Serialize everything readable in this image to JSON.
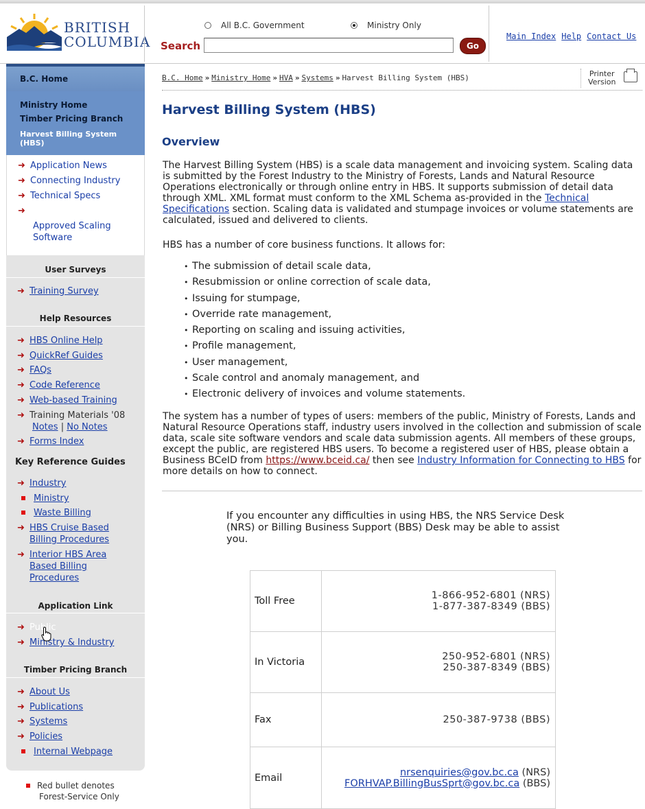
{
  "header": {
    "logo_line1": "BRITISH",
    "logo_line2": "COLUMBIA",
    "search_scope_all": "All B.C. Government",
    "search_scope_ministry": "Ministry Only",
    "search_label": "Search",
    "search_value": "",
    "go_label": "Go",
    "links": [
      "Main Index",
      "Help",
      "Contact Us"
    ]
  },
  "breadcrumb": {
    "items": [
      "B.C. Home",
      "Ministry Home",
      "HVA",
      "Systems"
    ],
    "current": "Harvest Billing System (HBS)",
    "printer_line1": "Printer",
    "printer_line2": "Version"
  },
  "sidebar": {
    "bc_home": "B.C. Home",
    "ministry_home": "Ministry Home",
    "timber_pricing": "Timber Pricing Branch",
    "hbs": "Harvest Billing System (HBS)",
    "apps": [
      "Application News",
      "Connecting Industry",
      "Technical Specs",
      "Approved Scaling Software"
    ],
    "user_surveys_heading": "User Surveys",
    "training_survey": "Training Survey",
    "help_heading": "Help Resources",
    "help_items": [
      "HBS Online Help",
      "QuickRef Guides",
      "FAQs",
      "Code Reference",
      "Web-based Training"
    ],
    "training_materials": "Training Materials '08",
    "notes": "Notes",
    "no_notes": "No Notes",
    "forms_index": "Forms Index",
    "keyref_heading": "Key Reference Guides",
    "keyref_items": [
      "Industry",
      "Ministry",
      "Waste Billing",
      "HBS Cruise Based Billing Procedures",
      "Interior HBS Area Based Billing Procedures"
    ],
    "applink_heading": "Application Link",
    "applink_items": [
      "Public",
      "Ministry & Industry"
    ],
    "tpb_heading": "Timber Pricing Branch",
    "tpb_items": [
      "About Us",
      "Publications",
      "Systems",
      "Policies",
      "Internal Webpage"
    ],
    "legend_line1": "Red bullet denotes",
    "legend_line2": "Forest-Service Only"
  },
  "content": {
    "title": "Harvest Billing System (HBS)",
    "overview_heading": "Overview",
    "p1_a": "The Harvest Billing System (HBS) is a scale data management and invoicing system. Scaling data is submitted by the Forest Industry to the Ministry of Forests, Lands and Natural Resource Operations electronically or through online entry in HBS.  It supports submission of detail data through XML.  XML format must conform to the XML Schema as-provided in the",
    "p1_link": "Technical Specifications",
    "p1_b": "section.  Scaling data is validated and stumpage invoices or volume statements are calculated, issued and delivered to clients.",
    "p2": "HBS has a number of core business functions.  It allows for:",
    "bullets": [
      "The submission of detail scale data,",
      "Resubmission or online correction of scale data,",
      "Issuing for stumpage,",
      "Override rate management,",
      "Reporting on scaling and issuing activities,",
      "Profile management,",
      "User management,",
      "Scale control and anomaly management, and",
      "Electronic delivery of invoices and volume statements."
    ],
    "p3_a": "The system has a number of types of users: members of the public, Ministry of Forests, Lands and Natural Resource Operations staff, industry users involved in the collection and submission of scale data, scale site software vendors and scale data submission agents.  All members of these groups, except the public, are registered HBS users.  To become a registered user of HBS, please obtain a Business BCeID from",
    "p3_link1": "https://www.bceid.ca/",
    "p3_b": "then see",
    "p3_link2": "Industry Information for Connecting to HBS",
    "p3_c": "for more details on how to connect.",
    "help_text": "If you encounter any difficulties in using HBS, the NRS Service Desk (NRS) or Billing Business Support (BBS) Desk may be able to assist you.",
    "contacts": [
      {
        "label": "Toll Free",
        "line1": "1-866-952-6801 (NRS)",
        "line2": "1-877-387-8349 (BBS)"
      },
      {
        "label": "In Victoria",
        "line1": "250-952-6801 (NRS)",
        "line2": "250-387-8349 (BBS)"
      },
      {
        "label": "Fax",
        "line1": "250-387-9738 (BBS)"
      },
      {
        "label": "Email",
        "email1": "nrsenquiries@gov.bc.ca",
        "suffix1": "(NRS)",
        "email2": "FORHVAP.BillingBusSprt@gov.bc.ca",
        "suffix2": "(BBS)"
      }
    ]
  },
  "colors": {
    "accent": "#1b3f86",
    "link": "#1a3ea8",
    "sidebar_blue": "#6a91c8",
    "go_button": "#8a1a12"
  }
}
